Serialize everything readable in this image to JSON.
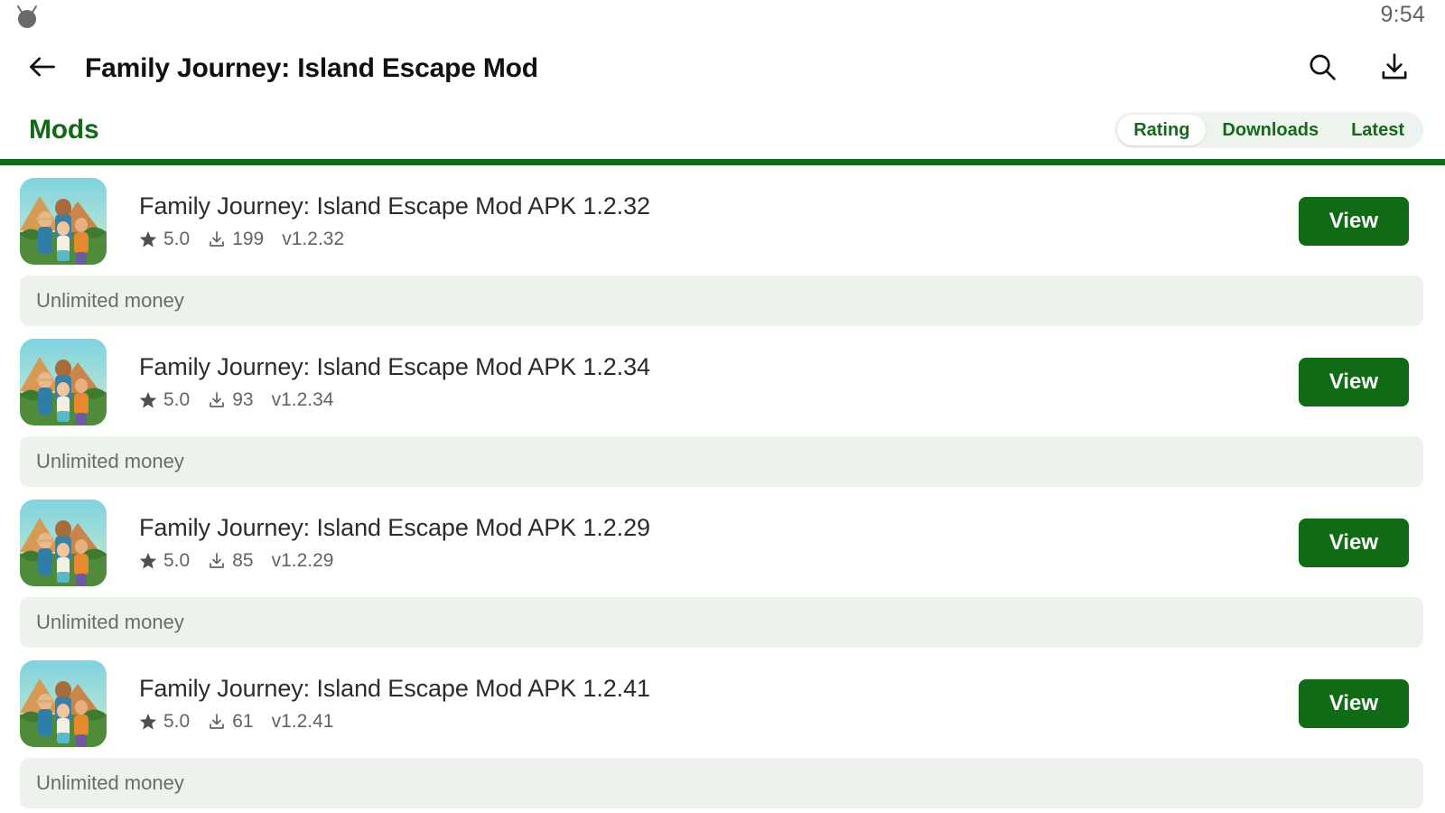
{
  "status_bar": {
    "robot_icon": "android-robot-icon",
    "clock": "9:54"
  },
  "app_bar": {
    "back_icon": "back-arrow-icon",
    "title": "Family Journey: Island Escape Mod",
    "search_icon": "search-icon",
    "download_icon": "download-icon"
  },
  "section": {
    "title": "Mods",
    "sort_tabs": [
      {
        "label": "Rating",
        "active": true
      },
      {
        "label": "Downloads",
        "active": false
      },
      {
        "label": "Latest",
        "active": false
      }
    ]
  },
  "theme": {
    "brand_green": "#116b16",
    "pill_track": "#edf3ed",
    "feature_bg": "#edf2ed",
    "title_color": "#2b2b2b",
    "meta_color": "#636363"
  },
  "mods": [
    {
      "title": "Family Journey: Island Escape Mod APK 1.2.32",
      "rating": "5.0",
      "downloads": "199",
      "version": "v1.2.32",
      "action_label": "View",
      "feature": "Unlimited money"
    },
    {
      "title": "Family Journey: Island Escape Mod APK 1.2.34",
      "rating": "5.0",
      "downloads": "93",
      "version": "v1.2.34",
      "action_label": "View",
      "feature": "Unlimited money"
    },
    {
      "title": "Family Journey: Island Escape Mod APK 1.2.29",
      "rating": "5.0",
      "downloads": "85",
      "version": "v1.2.29",
      "action_label": "View",
      "feature": "Unlimited money"
    },
    {
      "title": "Family Journey: Island Escape Mod APK 1.2.41",
      "rating": "5.0",
      "downloads": "61",
      "version": "v1.2.41",
      "action_label": "View",
      "feature": "Unlimited money"
    }
  ]
}
